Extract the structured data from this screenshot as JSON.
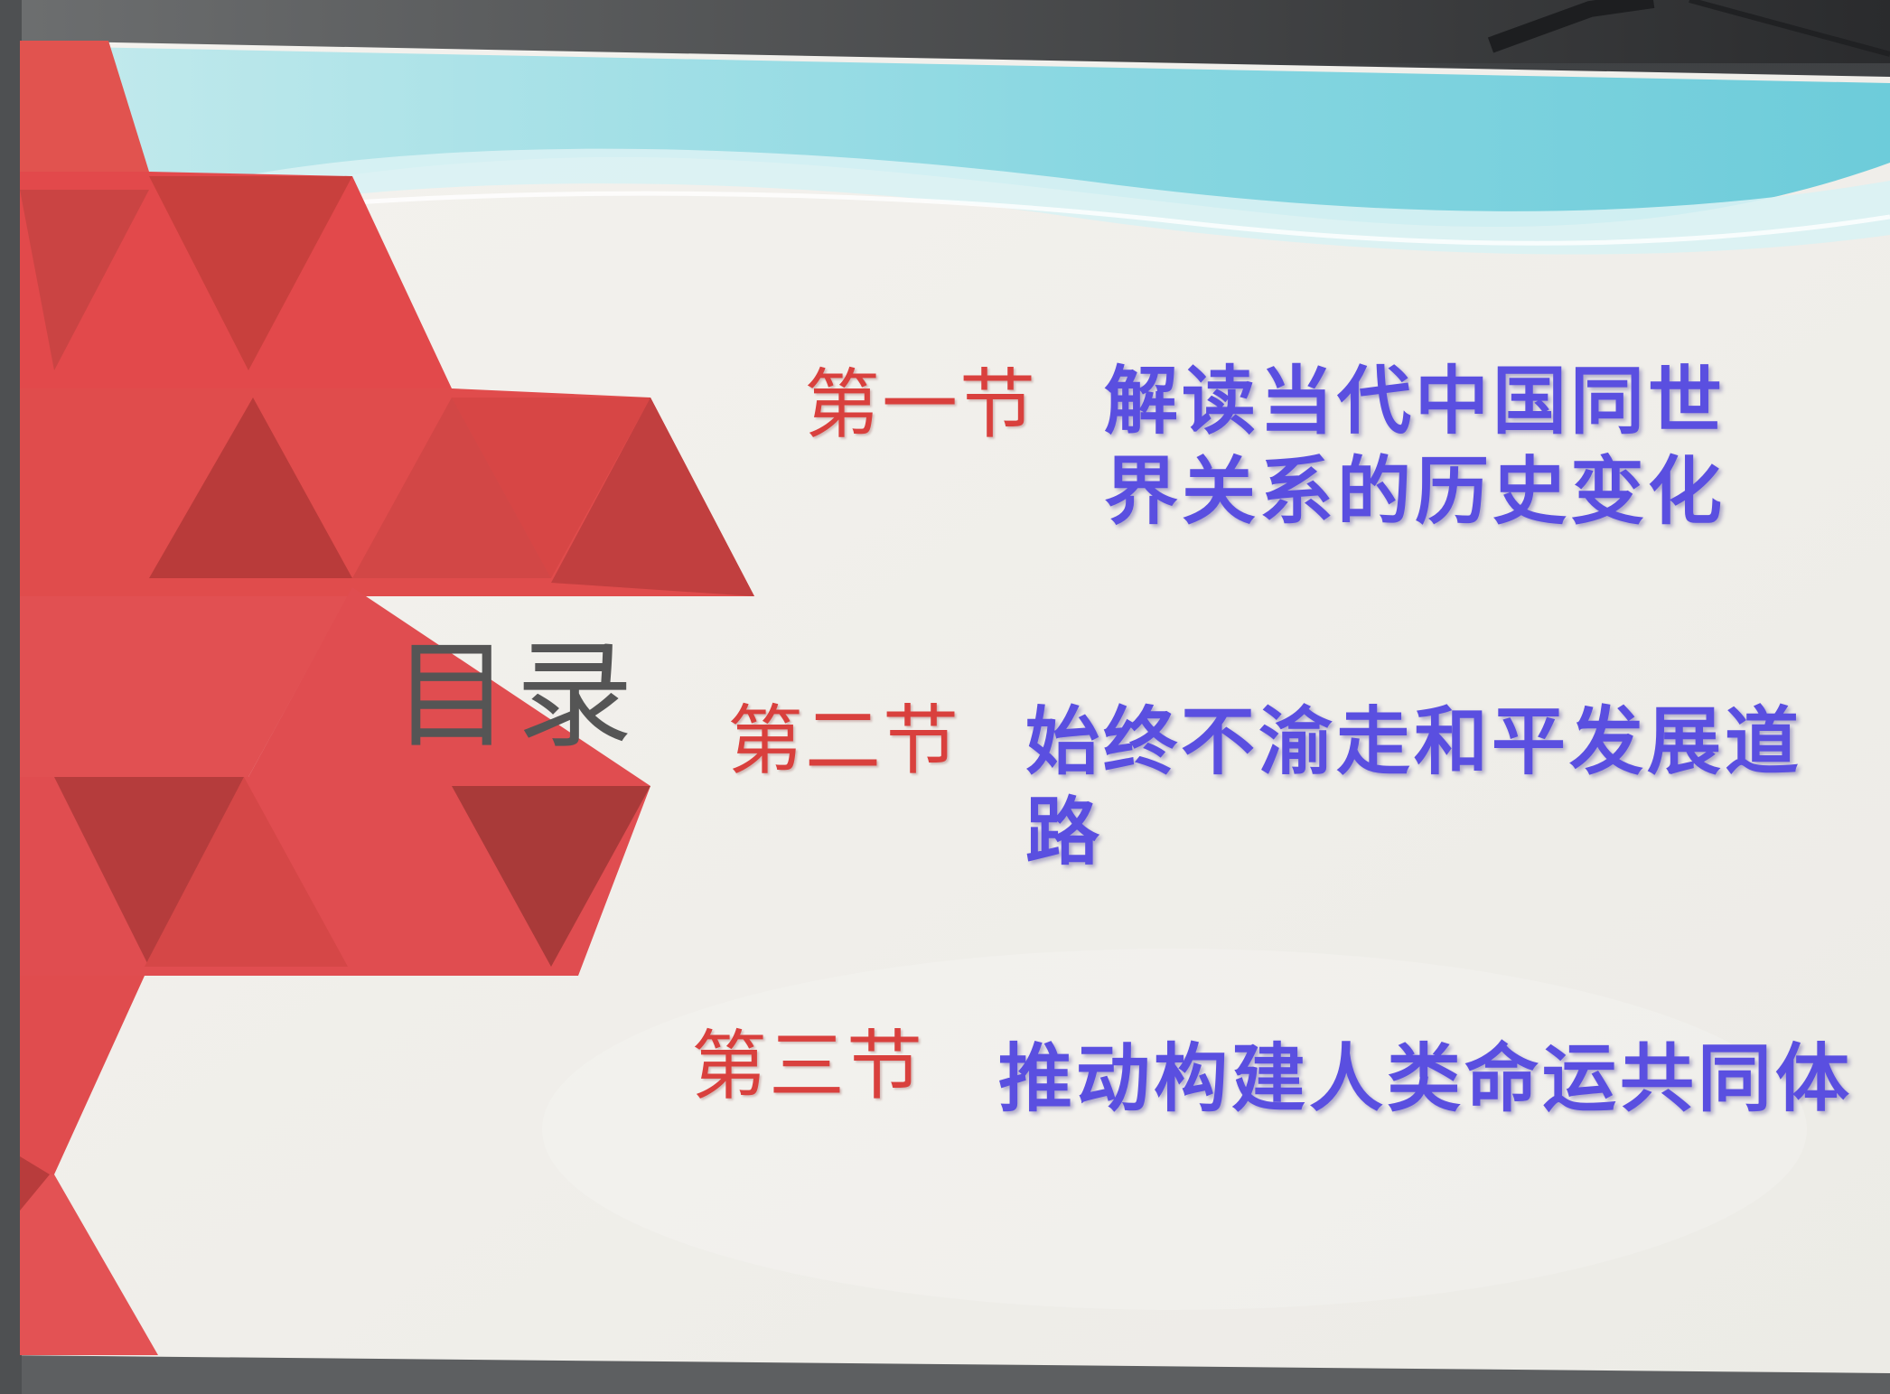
{
  "slide": {
    "title": "目录",
    "sections": [
      {
        "label": "第一节",
        "title": "解读当代中国同世界关系的历史变化"
      },
      {
        "label": "第二节",
        "title": "始终不渝走和平发展道路"
      },
      {
        "label": "第三节",
        "title": "推动构建人类命运共同体"
      }
    ]
  },
  "colors": {
    "accent_red": "#e04a4c",
    "label_red": "#d9403d",
    "title_blue": "#5a4fe0",
    "title_gray": "#555555",
    "wave_cyan": "#8fdbe3"
  }
}
